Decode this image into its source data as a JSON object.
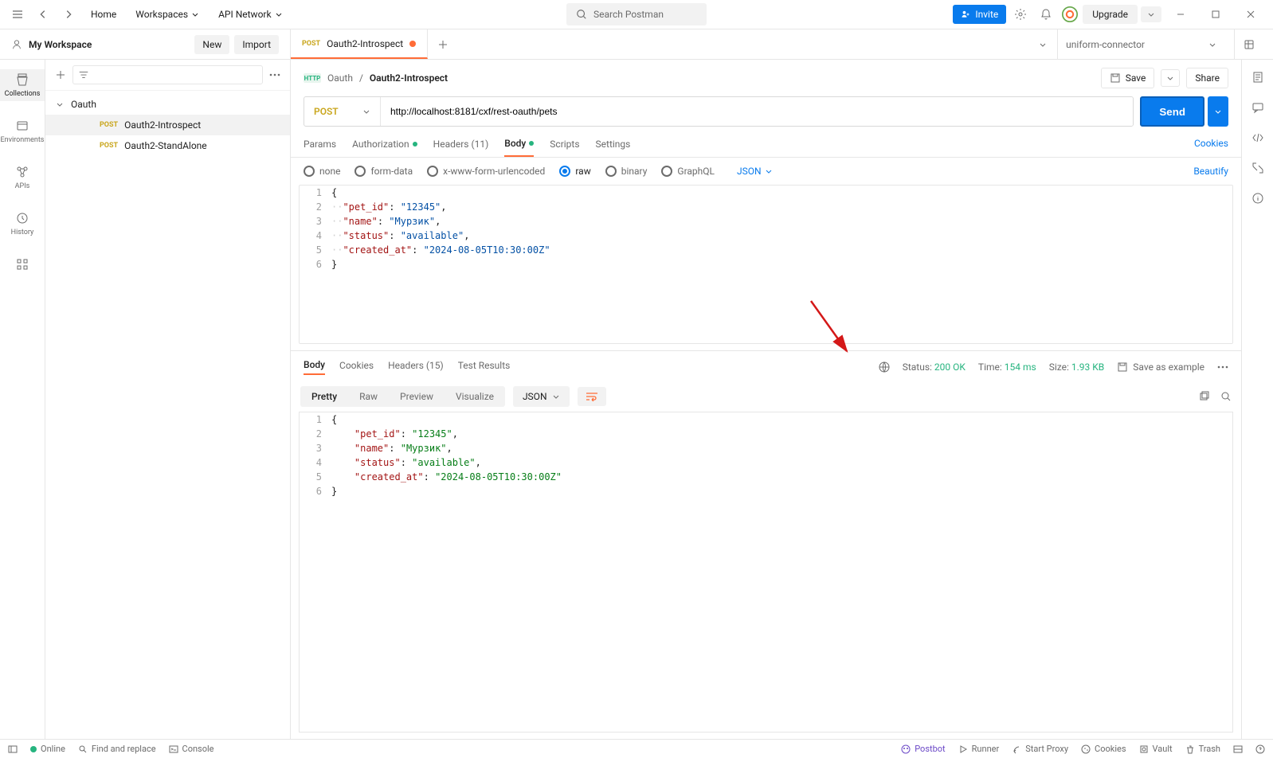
{
  "topbar": {
    "home": "Home",
    "workspaces": "Workspaces",
    "api_network": "API Network",
    "search_placeholder": "Search Postman",
    "invite": "Invite",
    "upgrade": "Upgrade"
  },
  "workspace": {
    "title": "My Workspace",
    "new_btn": "New",
    "import_btn": "Import"
  },
  "tab": {
    "method": "POST",
    "name": "Oauth2-Introspect"
  },
  "env": {
    "name": "uniform-connector"
  },
  "rail": {
    "collections": "Collections",
    "environments": "Environments",
    "apis": "APIs",
    "history": "History"
  },
  "tree": {
    "folder": "Oauth",
    "items": [
      {
        "method": "POST",
        "name": "Oauth2-Introspect"
      },
      {
        "method": "POST",
        "name": "Oauth2-StandAlone"
      }
    ]
  },
  "breadcrumb": {
    "parent": "Oauth",
    "current": "Oauth2-Introspect",
    "save": "Save",
    "share": "Share"
  },
  "request": {
    "method": "POST",
    "url": "http://localhost:8181/cxf/rest-oauth/pets",
    "send": "Send",
    "tabs": {
      "params": "Params",
      "auth": "Authorization",
      "headers": "Headers (11)",
      "body": "Body",
      "scripts": "Scripts",
      "settings": "Settings",
      "cookies": "Cookies"
    },
    "body_types": {
      "none": "none",
      "formdata": "form-data",
      "urlencoded": "x-www-form-urlencoded",
      "raw": "raw",
      "binary": "binary",
      "graphql": "GraphQL",
      "json": "JSON",
      "beautify": "Beautify"
    },
    "body_lines": [
      {
        "n": "1",
        "raw": "{"
      },
      {
        "n": "2",
        "raw": "  \"pet_id\": \"12345\","
      },
      {
        "n": "3",
        "raw": "  \"name\": \"Мурзик\","
      },
      {
        "n": "4",
        "raw": "  \"status\": \"available\","
      },
      {
        "n": "5",
        "raw": "  \"created_at\": \"2024-08-05T10:30:00Z\""
      },
      {
        "n": "6",
        "raw": "}"
      }
    ]
  },
  "response": {
    "tabs": {
      "body": "Body",
      "cookies": "Cookies",
      "headers": "Headers (15)",
      "tests": "Test Results"
    },
    "status_label": "Status:",
    "status_value": "200 OK",
    "time_label": "Time:",
    "time_value": "154 ms",
    "size_label": "Size:",
    "size_value": "1.93 KB",
    "save_example": "Save as example",
    "views": {
      "pretty": "Pretty",
      "raw": "Raw",
      "preview": "Preview",
      "visualize": "Visualize",
      "fmt": "JSON"
    },
    "body_lines": [
      {
        "n": "1",
        "raw": "{"
      },
      {
        "n": "2",
        "raw": "    \"pet_id\": \"12345\","
      },
      {
        "n": "3",
        "raw": "    \"name\": \"Мурзик\","
      },
      {
        "n": "4",
        "raw": "    \"status\": \"available\","
      },
      {
        "n": "5",
        "raw": "    \"created_at\": \"2024-08-05T10:30:00Z\""
      },
      {
        "n": "6",
        "raw": "}"
      }
    ]
  },
  "statusbar": {
    "online": "Online",
    "find": "Find and replace",
    "console": "Console",
    "postbot": "Postbot",
    "runner": "Runner",
    "proxy": "Start Proxy",
    "cookies": "Cookies",
    "vault": "Vault",
    "trash": "Trash"
  }
}
